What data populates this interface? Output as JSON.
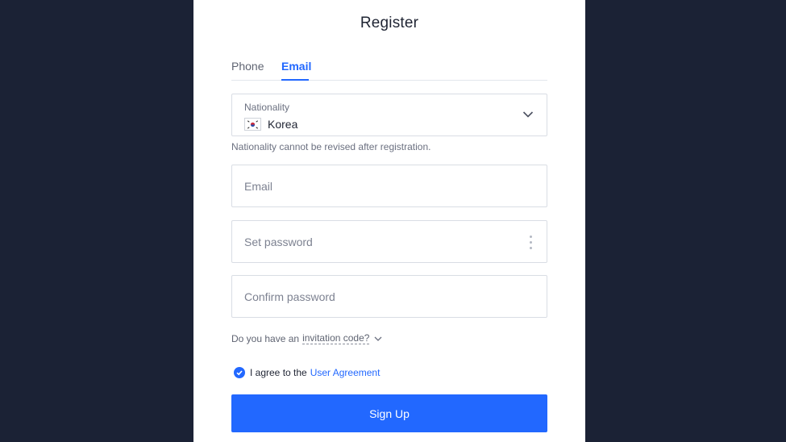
{
  "title": "Register",
  "tabs": [
    {
      "label": "Phone",
      "active": false
    },
    {
      "label": "Email",
      "active": true
    }
  ],
  "nationality": {
    "label": "Nationality",
    "value": "Korea",
    "hint": "Nationality cannot be revised after registration."
  },
  "email": {
    "placeholder": "Email",
    "value": ""
  },
  "password": {
    "placeholder": "Set password",
    "value": ""
  },
  "confirm_password": {
    "placeholder": "Confirm password",
    "value": ""
  },
  "invitation": {
    "prefix": "Do you have an",
    "link": "invitation code?"
  },
  "agreement": {
    "checked": true,
    "prefix": "I agree to the",
    "link": "User Agreement"
  },
  "signup_label": "Sign Up",
  "colors": {
    "accent": "#2268ff",
    "backdrop": "#1b2235",
    "card": "#ffffff"
  },
  "icons": {
    "nationality_dropdown": "chevron-down-icon",
    "password_menu": "kebab-icon",
    "invitation_toggle": "chevron-down-icon",
    "agreement_checkbox": "check-circle-icon",
    "flag": "korea-flag-icon"
  }
}
